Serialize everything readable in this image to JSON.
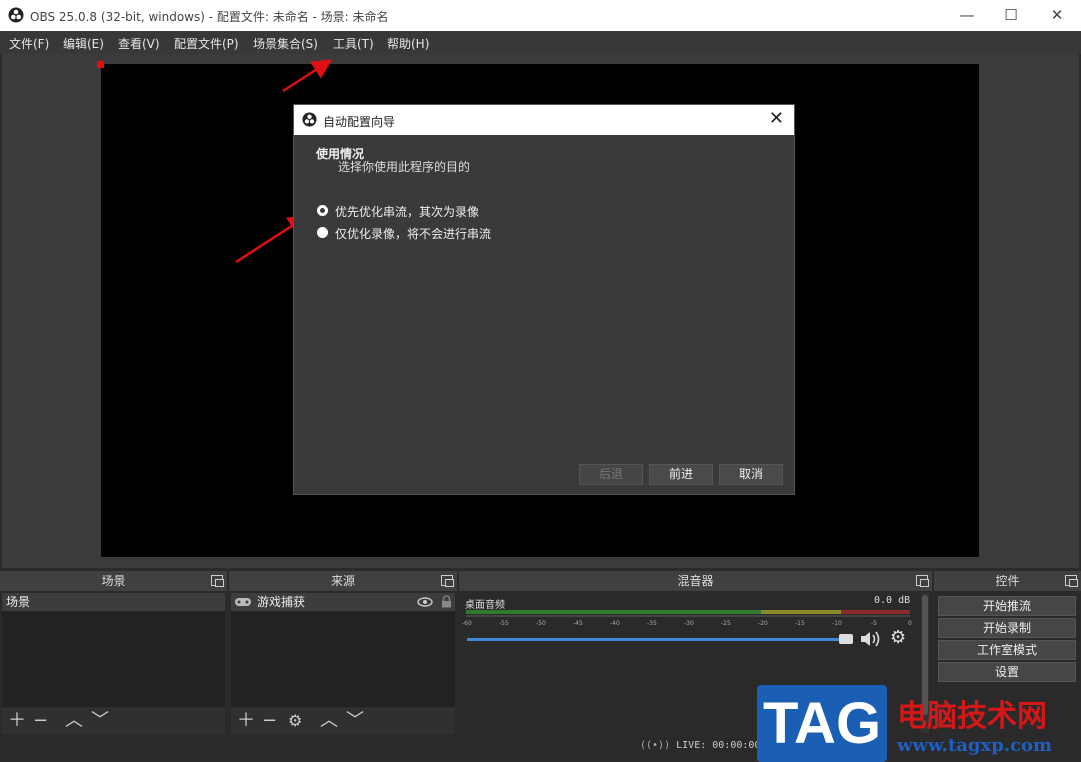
{
  "window": {
    "title": "OBS 25.0.8 (32-bit, windows) - 配置文件: 未命名 - 场景: 未命名",
    "minimize": "—",
    "maximize": "☐",
    "close": "✕"
  },
  "menu": [
    "文件(F)",
    "编辑(E)",
    "查看(V)",
    "配置文件(P)",
    "场景集合(S)",
    "工具(T)",
    "帮助(H)"
  ],
  "dialog": {
    "title": "自动配置向导",
    "close": "✕",
    "section_title": "使用情况",
    "section_subtitle": "选择你使用此程序的目的",
    "options": [
      {
        "label": "优先优化串流，其次为录像",
        "selected": true
      },
      {
        "label": "仅优化录像，将不会进行串流",
        "selected": false
      }
    ],
    "buttons": {
      "back": "后退",
      "next": "前进",
      "cancel": "取消"
    }
  },
  "docks": {
    "scenes": {
      "title": "场景",
      "items": [
        "场景"
      ]
    },
    "sources": {
      "title": "来源",
      "items": [
        "游戏捕获"
      ]
    },
    "mixer": {
      "title": "混音器",
      "channel": "桌面音频",
      "level": "0.0 dB",
      "scale": [
        "-60",
        "-55",
        "-50",
        "-45",
        "-40",
        "-35",
        "-30",
        "-25",
        "-20",
        "-15",
        "-10",
        "-5",
        "0"
      ],
      "volume_fraction": 1.0
    },
    "controls": {
      "title": "控件",
      "buttons": [
        "开始推流",
        "开始录制",
        "工作室模式",
        "设置"
      ]
    }
  },
  "status": {
    "live": "LIVE: 00:00:00"
  },
  "watermark": {
    "tag": "TAG",
    "site": "电脑技术网",
    "url": "www.tagxp.com"
  },
  "colors": {
    "accent": "#3f8ad8",
    "arrow": "#e01010"
  }
}
